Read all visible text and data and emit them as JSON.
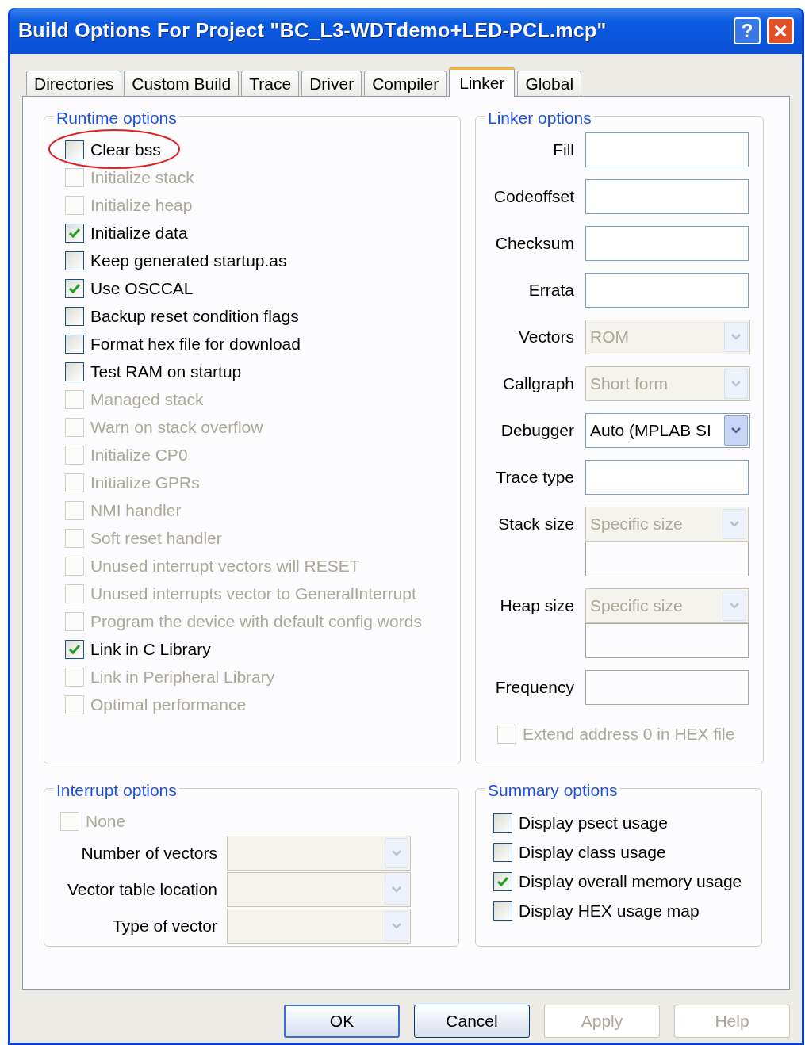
{
  "window": {
    "title": "Build Options For Project \"BC_L3-WDTdemo+LED-PCL.mcp\"",
    "help_button": "?",
    "close_button": "×"
  },
  "tabs": [
    {
      "label": "Directories",
      "selected": false
    },
    {
      "label": "Custom Build",
      "selected": false
    },
    {
      "label": "Trace",
      "selected": false
    },
    {
      "label": "Driver",
      "selected": false
    },
    {
      "label": "Compiler",
      "selected": false
    },
    {
      "label": "Linker",
      "selected": true
    },
    {
      "label": "Global",
      "selected": false
    }
  ],
  "runtime_options": {
    "title": "Runtime options",
    "items": [
      {
        "label": "Clear bss",
        "checked": false,
        "disabled": false,
        "circled": true
      },
      {
        "label": "Initialize stack",
        "checked": false,
        "disabled": true
      },
      {
        "label": "Initialize heap",
        "checked": false,
        "disabled": true
      },
      {
        "label": "Initialize data",
        "checked": true,
        "disabled": false
      },
      {
        "label": "Keep generated startup.as",
        "checked": false,
        "disabled": false
      },
      {
        "label": "Use OSCCAL",
        "checked": true,
        "disabled": false
      },
      {
        "label": "Backup reset condition flags",
        "checked": false,
        "disabled": false
      },
      {
        "label": "Format hex file for download",
        "checked": false,
        "disabled": false
      },
      {
        "label": "Test RAM on startup",
        "checked": false,
        "disabled": false
      },
      {
        "label": "Managed stack",
        "checked": false,
        "disabled": true
      },
      {
        "label": "Warn on stack overflow",
        "checked": false,
        "disabled": true
      },
      {
        "label": "Initialize CP0",
        "checked": false,
        "disabled": true
      },
      {
        "label": "Initialize GPRs",
        "checked": false,
        "disabled": true
      },
      {
        "label": "NMI handler",
        "checked": false,
        "disabled": true
      },
      {
        "label": "Soft reset handler",
        "checked": false,
        "disabled": true
      },
      {
        "label": "Unused interrupt vectors will RESET",
        "checked": false,
        "disabled": true
      },
      {
        "label": "Unused interrupts vector to GeneralInterrupt",
        "checked": false,
        "disabled": true
      },
      {
        "label": "Program the device with default config words",
        "checked": false,
        "disabled": true
      },
      {
        "label": "Link in C Library",
        "checked": true,
        "disabled": false
      },
      {
        "label": "Link in Peripheral Library",
        "checked": false,
        "disabled": true
      },
      {
        "label": "Optimal performance",
        "checked": false,
        "disabled": true
      }
    ]
  },
  "linker_options": {
    "title": "Linker options",
    "fields": [
      {
        "label": "Fill",
        "kind": "text",
        "disabled": false
      },
      {
        "label": "Codeoffset",
        "kind": "text",
        "disabled": false
      },
      {
        "label": "Checksum",
        "kind": "text",
        "disabled": false
      },
      {
        "label": "Errata",
        "kind": "text",
        "disabled": false
      },
      {
        "label": "Vectors",
        "kind": "combo",
        "value": "ROM",
        "disabled": true
      },
      {
        "label": "Callgraph",
        "kind": "combo",
        "value": "Short form",
        "disabled": true
      },
      {
        "label": "Debugger",
        "kind": "combo",
        "value": "Auto (MPLAB SI",
        "disabled": false
      },
      {
        "label": "Trace type",
        "kind": "text",
        "disabled": false
      },
      {
        "label": "Stack size",
        "kind": "combo_text",
        "value": "Specific size",
        "disabled": true
      },
      {
        "label": "Heap size",
        "kind": "combo_text",
        "value": "Specific size",
        "disabled": true
      },
      {
        "label": "Frequency",
        "kind": "text",
        "disabled": true
      },
      {
        "label": "Extend address 0 in HEX file",
        "kind": "checkbox",
        "checked": false,
        "disabled": true
      }
    ]
  },
  "interrupt_options": {
    "title": "Interrupt options",
    "none": {
      "label": "None",
      "checked": false,
      "disabled": true
    },
    "fields": [
      {
        "label": "Number of vectors",
        "disabled": true
      },
      {
        "label": "Vector table location",
        "disabled": true
      },
      {
        "label": "Type of vector",
        "disabled": true
      }
    ]
  },
  "summary_options": {
    "title": "Summary options",
    "items": [
      {
        "label": "Display psect usage",
        "checked": false
      },
      {
        "label": "Display class usage",
        "checked": false
      },
      {
        "label": "Display overall memory usage",
        "checked": true
      },
      {
        "label": "Display HEX usage map",
        "checked": false
      }
    ]
  },
  "buttons": [
    {
      "label": "OK",
      "kind": "default",
      "disabled": false
    },
    {
      "label": "Cancel",
      "kind": "normal",
      "disabled": false
    },
    {
      "label": "Apply",
      "kind": "normal",
      "disabled": true
    },
    {
      "label": "Help",
      "kind": "normal",
      "disabled": true
    }
  ]
}
